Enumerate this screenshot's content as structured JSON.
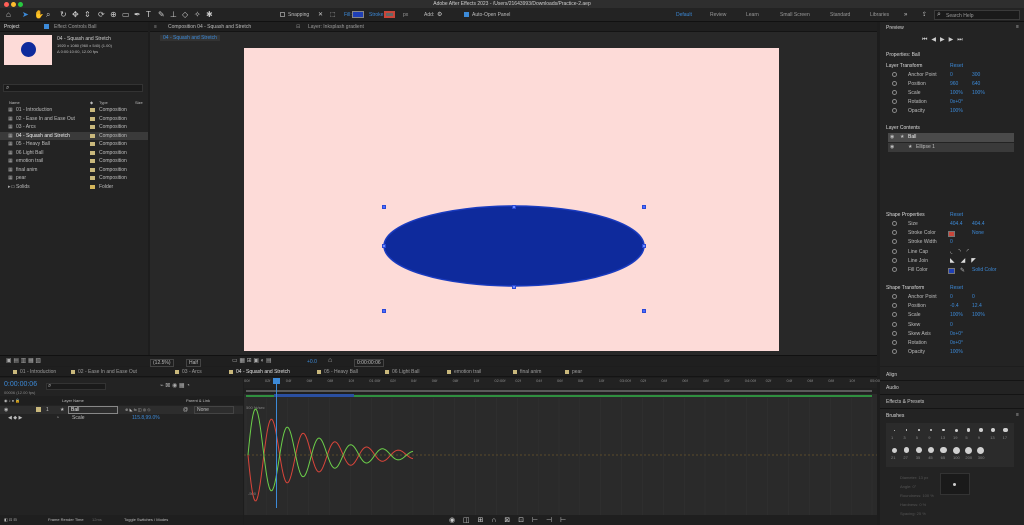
{
  "app": {
    "window_title": "Adobe After Effects 2023 - /Users/21643993/Downloads/Practice-2.aep"
  },
  "toolbar": {
    "snapping_label": "Snapping",
    "fill_label": "Fill:",
    "stroke_label": "Stroke:",
    "stroke_px": "px",
    "add_label": "Add:",
    "auto_open_label": "Auto-Open Panel",
    "workspaces": [
      "Default",
      "Review",
      "Learn",
      "Small Screen",
      "Standard",
      "Libraries"
    ],
    "search_placeholder": "Search Help",
    "fill_color": "#1f3fb5",
    "stroke_color": "#c9463a"
  },
  "project_panel": {
    "tab_project": "Project",
    "tab_effect_controls": "Effect Controls Ball",
    "comp_name": "04 - Squash and Stretch",
    "comp_info_1": "1920 x 1080  (960 x 540) (1.00)",
    "comp_info_2": "Δ 0:00:10:00, 12.00 fps",
    "col_name": "Name",
    "col_type": "Type",
    "col_size": "Size",
    "items": [
      {
        "name": "01 - Introduction",
        "type": "Composition"
      },
      {
        "name": "02 - Ease In and Ease Out",
        "type": "Composition"
      },
      {
        "name": "03 - Arcs",
        "type": "Composition"
      },
      {
        "name": "04 - Squash and Stretch",
        "type": "Composition"
      },
      {
        "name": "05 - Heavy Ball",
        "type": "Composition"
      },
      {
        "name": "06 Light Ball",
        "type": "Composition"
      },
      {
        "name": "emotion trail",
        "type": "Composition"
      },
      {
        "name": "final anim",
        "type": "Composition"
      },
      {
        "name": "pear",
        "type": "Composition"
      },
      {
        "name": "Solids",
        "type": "Folder"
      }
    ],
    "footer_bpc": "8 bpc"
  },
  "comp_panel": {
    "tab_label": "Composition 04 - Squash and Stretch",
    "layer_tab": "Layer: Inksplash gradient",
    "breadcrumb": "04 - Squash and Stretch",
    "bg_color": "#fddbd8",
    "ball_color": "#0e2a9c",
    "footer_zoom": "(12.5%)",
    "footer_res": "Half",
    "footer_exposure": "+0.0",
    "footer_time": "0:00:00:06"
  },
  "right_panel": {
    "preview": "Preview",
    "properties_title": "Properties: Ball",
    "layer_transform": "Layer Transform",
    "reset": "Reset",
    "transform_props": [
      {
        "label": "Anchor Point",
        "v1": "0",
        "v2": "300"
      },
      {
        "label": "Position",
        "v1": "960",
        "v2": "640"
      },
      {
        "label": "Scale",
        "v1": "100%",
        "v2": "100%"
      },
      {
        "label": "Rotation",
        "v1": "0x+0°",
        "v2": ""
      },
      {
        "label": "Opacity",
        "v1": "100%",
        "v2": ""
      }
    ],
    "layer_contents": "Layer Contents",
    "contents": [
      "Ball",
      "Ellipse 1"
    ],
    "shape_properties": "Shape Properties",
    "shape_props": [
      {
        "label": "Size",
        "v1": "404.4",
        "v2": "404.4"
      },
      {
        "label": "Stroke Color",
        "v1": "",
        "v2": "None"
      },
      {
        "label": "Stroke Width",
        "v1": "0",
        "v2": ""
      },
      {
        "label": "Line Cap",
        "v1": "",
        "v2": ""
      },
      {
        "label": "Line Join",
        "v1": "",
        "v2": ""
      },
      {
        "label": "Fill Color",
        "v1": "",
        "v2": "Solid Color"
      }
    ],
    "shape_transform": "Shape Transform",
    "shape_transform_props": [
      {
        "label": "Anchor Point",
        "v1": "0",
        "v2": "0"
      },
      {
        "label": "Position",
        "v1": "-0.4",
        "v2": "12.4"
      },
      {
        "label": "Scale",
        "v1": "100%",
        "v2": "100%"
      },
      {
        "label": "Skew",
        "v1": "0",
        "v2": ""
      },
      {
        "label": "Skew Axis",
        "v1": "0x+0°",
        "v2": ""
      },
      {
        "label": "Rotation",
        "v1": "0x+0°",
        "v2": ""
      },
      {
        "label": "Opacity",
        "v1": "100%",
        "v2": ""
      }
    ],
    "lower_panels": [
      "Align",
      "Audio",
      "Effects & Presets"
    ],
    "brushes": "Brushes",
    "brush_sizes": [
      "1",
      "3",
      "5",
      "9",
      "13",
      "19",
      "5",
      "9",
      "13",
      "17",
      "21",
      "27",
      "35",
      "45",
      "65",
      "100",
      "200",
      "300"
    ],
    "brush_info": [
      "Diameter: 13 px",
      "Angle: 0°",
      "Roundness: 100 %",
      "Hardness: 0 %",
      "Spacing: 25 %"
    ]
  },
  "timeline": {
    "tabs": [
      "01 - Introduction",
      "02 - Ease In and Ease Out",
      "03 - Arcs",
      "04 - Squash and Stretch",
      "05 - Heavy Ball",
      "06 Light Ball",
      "emotion trail",
      "final anim",
      "pear"
    ],
    "current_time": "0:00:00:06",
    "fps_info": "00006 (12.00 fps)",
    "col_layer_name": "Layer Name",
    "col_parent": "Parent & Link",
    "layer_num": "1",
    "layer_name": "Ball",
    "parent_value": "None",
    "property_name": "Scale",
    "property_value": "115.8,99.0%",
    "ruler_marks": [
      "00f",
      "02f",
      "04f",
      "06f",
      "08f",
      "10f",
      "01:00f",
      "02f",
      "04f",
      "06f",
      "08f",
      "10f",
      "02:00f",
      "02f",
      "04f",
      "06f",
      "08f",
      "10f",
      "03:00f",
      "02f",
      "04f",
      "06f",
      "08f",
      "10f",
      "04:00f",
      "02f",
      "04f",
      "06f",
      "08f",
      "10f",
      "05:00f"
    ],
    "graph_top_label": "500 %/sec",
    "graph_bottom_label": "-500",
    "footer_left": "Frame Render Time",
    "footer_ms": "12ms",
    "footer_right": "Toggle Switches / Modes",
    "curve_red": "#d9453a",
    "curve_green": "#6ccf4a"
  }
}
